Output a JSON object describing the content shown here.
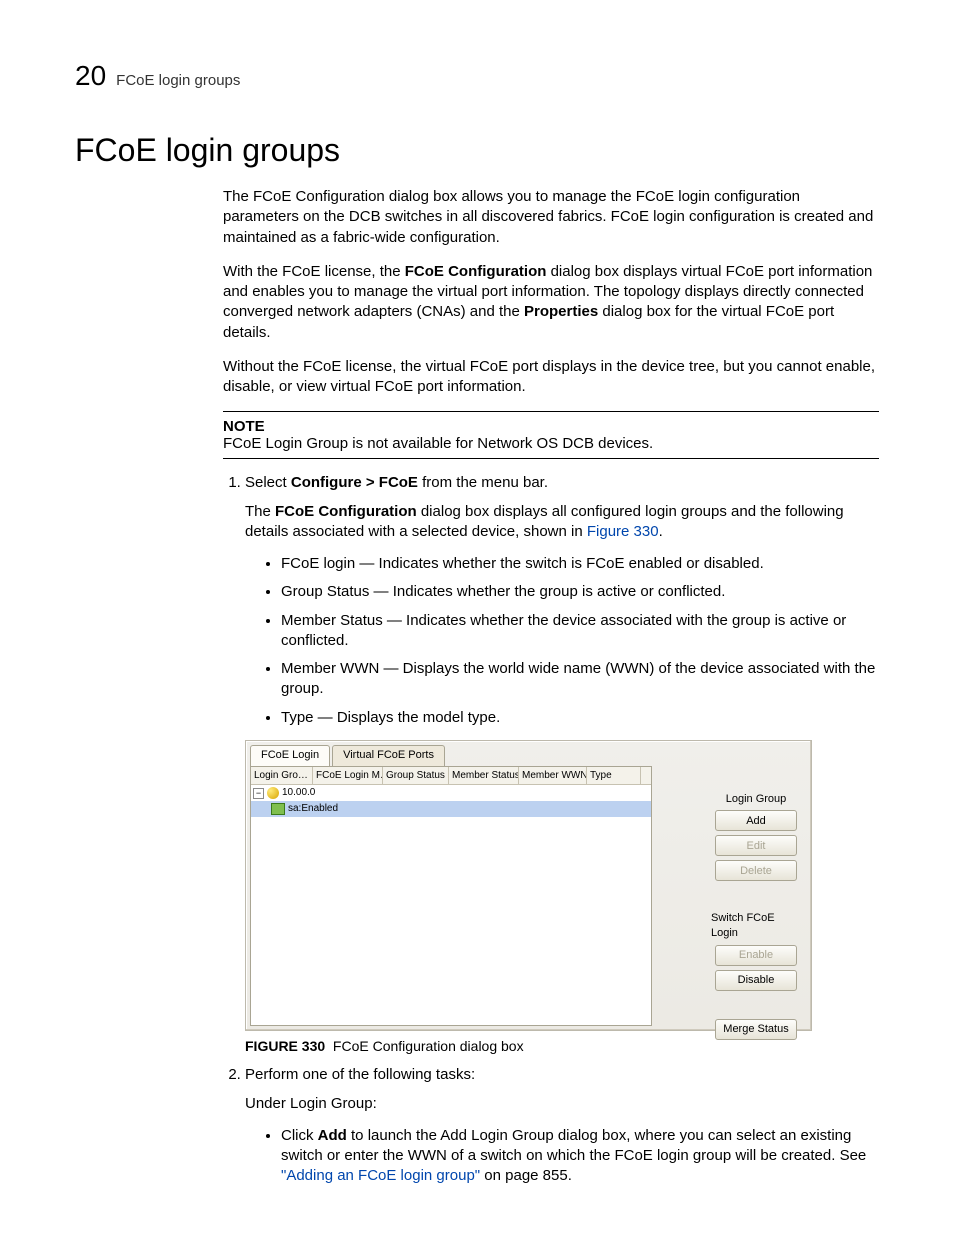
{
  "header": {
    "chapter_number": "20",
    "running_title": "FCoE login groups"
  },
  "section_title": "FCoE login groups",
  "para1_text": "The FCoE Configuration dialog box allows you to manage the FCoE login configuration parameters on the DCB switches in all discovered fabrics. FCoE login configuration is created and maintained as a fabric-wide configuration.",
  "para2_pre": "With the FCoE license, the ",
  "para2_bold1": "FCoE Configuration",
  "para2_mid": " dialog box displays virtual FCoE port information and enables you to manage the virtual port information. The topology displays directly connected converged network adapters (CNAs) and the ",
  "para2_bold2": "Properties",
  "para2_post": " dialog box for the virtual FCoE port details.",
  "para3_text": "Without the FCoE license, the virtual FCoE port displays in the device tree, but you cannot enable, disable, or view virtual FCoE port information.",
  "note": {
    "label": "NOTE",
    "text": "FCoE Login Group is not available for Network OS DCB devices."
  },
  "step1": {
    "pre": "Select ",
    "bold": "Configure > FCoE",
    "post": " from the menu bar.",
    "sub_pre": "The ",
    "sub_bold": "FCoE Configuration",
    "sub_mid": " dialog box displays all configured login groups and the following details associated with a selected device, shown in ",
    "figlink_text": "Figure 330",
    "sub_post": ".",
    "bullets": [
      "FCoE login — Indicates whether the switch is FCoE enabled or disabled.",
      "Group Status — Indicates whether the group is active or conflicted.",
      "Member Status — Indicates whether the device associated with the group is active or conflicted.",
      "Member WWN — Displays the world wide name (WWN) of the device associated with the group.",
      "Type — Displays the model type."
    ]
  },
  "dialog": {
    "tabs": {
      "active": "FCoE Login",
      "inactive": "Virtual FCoE Ports"
    },
    "columns": [
      "Login Gro…",
      "FCoE Login M…",
      "Group Status",
      "Member Status",
      "Member WWN",
      "Type"
    ],
    "tree_root_label": "10.00.0",
    "tree_child_prefix": "sa:",
    "tree_child_value": "Enabled",
    "right": {
      "group_label": "Login Group",
      "add": "Add",
      "edit": "Edit",
      "delete": "Delete",
      "switch_label": "Switch FCoE Login",
      "enable": "Enable",
      "disable": "Disable",
      "merge": "Merge Status"
    }
  },
  "figure_caption": {
    "num": "FIGURE 330",
    "title": "FCoE Configuration dialog box"
  },
  "step2": {
    "intro": "Perform one of the following tasks:",
    "sub": "Under Login Group:",
    "bullet_pre": "Click ",
    "bullet_bold": "Add",
    "bullet_mid": " to launch the Add Login Group dialog box, where you can select an existing switch or enter the WWN of a switch on which the FCoE login group will be created. See ",
    "xref_text": "\"Adding an FCoE login group\"",
    "bullet_post": " on page 855."
  }
}
